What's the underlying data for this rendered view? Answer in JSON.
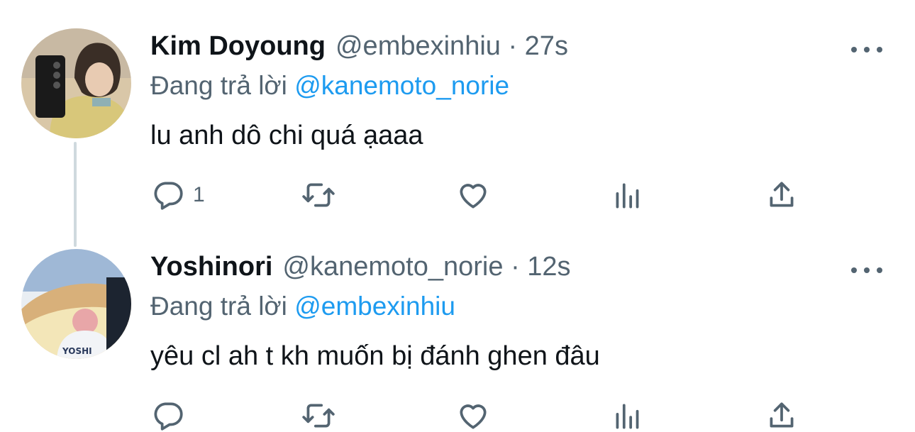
{
  "tweets": [
    {
      "name": "Kim Doyoung",
      "handle": "@embexinhiu · 27s",
      "reply_prefix": "Đang trả lời",
      "reply_mention": "@kanemoto_norie",
      "text": "lu anh dô chi quá ạaaa",
      "reply_count": "1",
      "icons": [
        "reply-icon",
        "retweet-icon",
        "like-icon",
        "stats-icon",
        "share-icon",
        "more-icon"
      ]
    },
    {
      "name": "Yoshinori",
      "handle": "@kanemoto_norie · 12s",
      "reply_prefix": "Đang trả lời",
      "reply_mention": "@embexinhiu",
      "text": "yêu cl ah t kh muốn bị đánh ghen đâu",
      "reply_count": "",
      "icons": [
        "reply-icon",
        "retweet-icon",
        "like-icon",
        "stats-icon",
        "share-icon",
        "more-icon"
      ]
    }
  ],
  "colors": {
    "text": "#0f1419",
    "secondary": "#536471",
    "mention": "#1d9bf0",
    "thread_line": "#cfd9de"
  }
}
